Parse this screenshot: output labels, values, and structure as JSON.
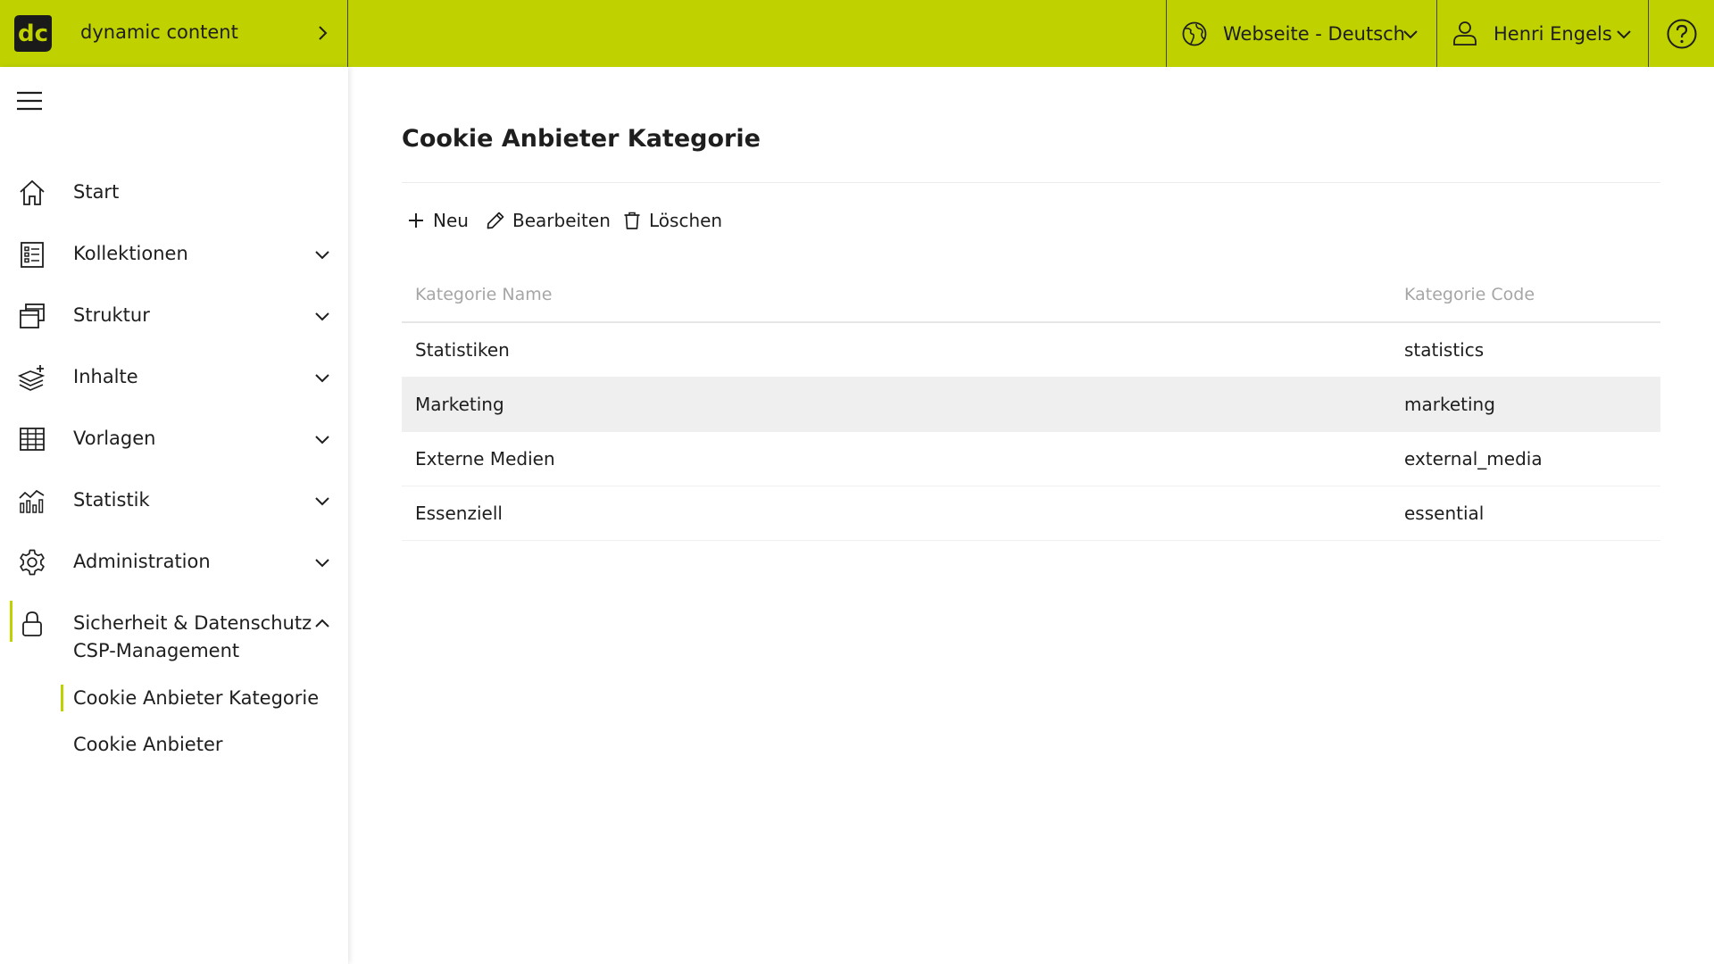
{
  "header": {
    "app_name": "dynamic content",
    "logo_text": "dc",
    "website_selector": "Webseite - Deutsch",
    "user_name": "Henri Engels",
    "accent_color": "#bfd200"
  },
  "sidebar": {
    "items": [
      {
        "label": "Start",
        "icon": "home-icon"
      },
      {
        "label": "Kollektionen",
        "icon": "collection-list-icon"
      },
      {
        "label": "Struktur",
        "icon": "structure-windows-icon"
      },
      {
        "label": "Inhalte",
        "icon": "content-layers-icon"
      },
      {
        "label": "Vorlagen",
        "icon": "template-grid-icon"
      },
      {
        "label": "Statistik",
        "icon": "statistics-chart-icon"
      },
      {
        "label": "Administration",
        "icon": "gear-icon"
      },
      {
        "label": "Sicherheit & Datenschutz",
        "icon": "lock-icon"
      }
    ],
    "subitems": [
      {
        "label": "CSP-Management"
      },
      {
        "label": "Cookie Anbieter Kategorie"
      },
      {
        "label": "Cookie Anbieter"
      }
    ]
  },
  "main": {
    "title": "Cookie Anbieter Kategorie",
    "toolbar": {
      "new_label": "Neu",
      "edit_label": "Bearbeiten",
      "delete_label": "Löschen"
    },
    "table": {
      "columns": [
        "Kategorie Name",
        "Kategorie Code"
      ],
      "rows": [
        {
          "name": "Statistiken",
          "code": "statistics"
        },
        {
          "name": "Marketing",
          "code": "marketing"
        },
        {
          "name": "Externe Medien",
          "code": "external_media"
        },
        {
          "name": "Essenziell",
          "code": "essential"
        }
      ]
    }
  }
}
